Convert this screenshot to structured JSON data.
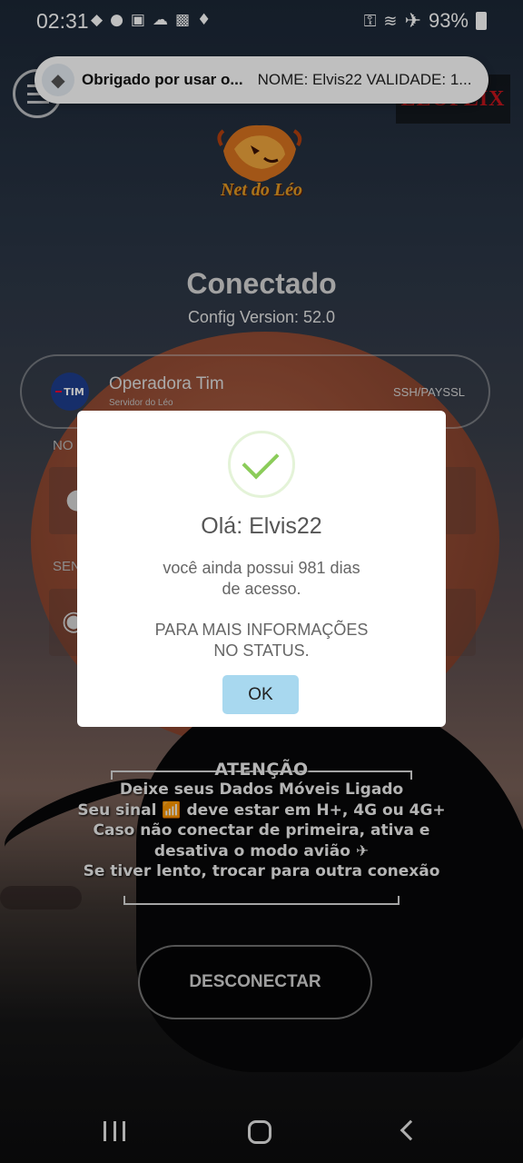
{
  "status_bar": {
    "time": "02:31",
    "battery": "93%",
    "left_icons": [
      "notification-icon",
      "messenger-icon",
      "call-icon",
      "cloud-icon",
      "image-icon",
      "bulb-icon"
    ],
    "right_icons": [
      "key-icon",
      "wifi-icon",
      "airplane-icon",
      "battery-icon"
    ]
  },
  "notification": {
    "title": "Obrigado por usar o...",
    "message": "NOME: Elvis22 VALIDADE: 1..."
  },
  "header": {
    "logo_text": "Net do Léo",
    "netflix_label": "LEOFLIX"
  },
  "connection": {
    "status": "Conectado",
    "config_version": "Config Version: 52.0"
  },
  "server": {
    "badge": "TIM",
    "name": "Operadora Tim",
    "subtitle": "Servidor do Léo",
    "protocol": "SSH/PAYSSL"
  },
  "fields": {
    "user_label": "NO",
    "password_label": "SEN"
  },
  "attention": {
    "heading": "ATENÇÃO",
    "lines": [
      "Deixe seus Dados Móveis Ligado",
      "Seu sinal 📶 deve estar em H+, 4G ou 4G+",
      "Caso não conectar de primeira, ativa e",
      "desativa o modo avião ✈",
      "Se tiver lento, trocar para outra conexão"
    ]
  },
  "disconnect_button": "DESCONECTAR",
  "dialog": {
    "title": "Olá: Elvis22",
    "text_line1": "você ainda possui 981 dias",
    "text_line2": "de acesso.",
    "info_line1": "PARA MAIS INFORMAÇÕES",
    "info_line2": "NO STATUS.",
    "ok_label": "OK"
  },
  "colors": {
    "accent_ok": "#a8d8ef",
    "check_green": "#8bcc5a",
    "netflix_red": "#c4151c"
  }
}
